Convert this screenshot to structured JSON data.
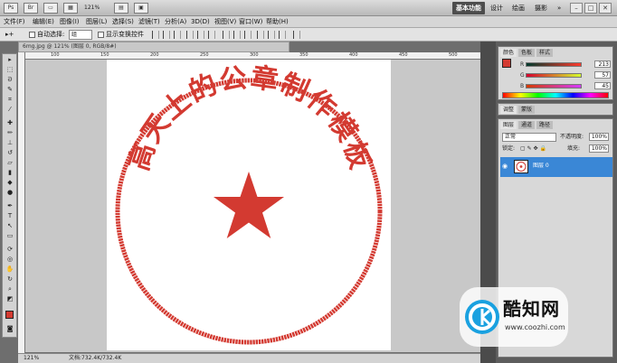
{
  "appbar": {
    "zoom": "121%",
    "workspaces": [
      "基本功能",
      "设计",
      "绘画",
      "摄影"
    ],
    "more": "»"
  },
  "menu": [
    "文件(F)",
    "编辑(E)",
    "图像(I)",
    "图层(L)",
    "选择(S)",
    "滤镜(T)",
    "分析(A)",
    "3D(D)",
    "视图(V)",
    "窗口(W)",
    "帮助(H)"
  ],
  "options": {
    "autoselect_label": "自动选择:",
    "autoselect_value": "组",
    "transform_label": "显示变换控件"
  },
  "document": {
    "tab_title": "6mg.jpg @ 121% (图层 0, RGB/8#)",
    "ruler_ticks": [
      "100",
      "150",
      "200",
      "250",
      "300",
      "350",
      "400",
      "450",
      "500"
    ],
    "zoom_status": "121%",
    "doc_size": "文档:732.4K/732.4K"
  },
  "seal": {
    "text": "高天上的公章制作模板",
    "color": "#d33a31"
  },
  "color_panel": {
    "tabs": [
      "颜色",
      "色板",
      "样式"
    ],
    "r": "213",
    "g": "57",
    "b": "45",
    "r_label": "R",
    "g_label": "G",
    "b_label": "B"
  },
  "swatches": {
    "tabs": [
      "调整",
      "蒙版"
    ]
  },
  "layers_panel": {
    "tabs": [
      "图层",
      "通道",
      "路径"
    ],
    "blend_mode": "正常",
    "opacity_label": "不透明度:",
    "opacity": "100%",
    "lock_label": "锁定:",
    "fill_label": "填充:",
    "fill": "100%",
    "layer_name": "图层 0"
  },
  "watermark": {
    "title": "酷知网",
    "url": "www.coozhi.com"
  }
}
